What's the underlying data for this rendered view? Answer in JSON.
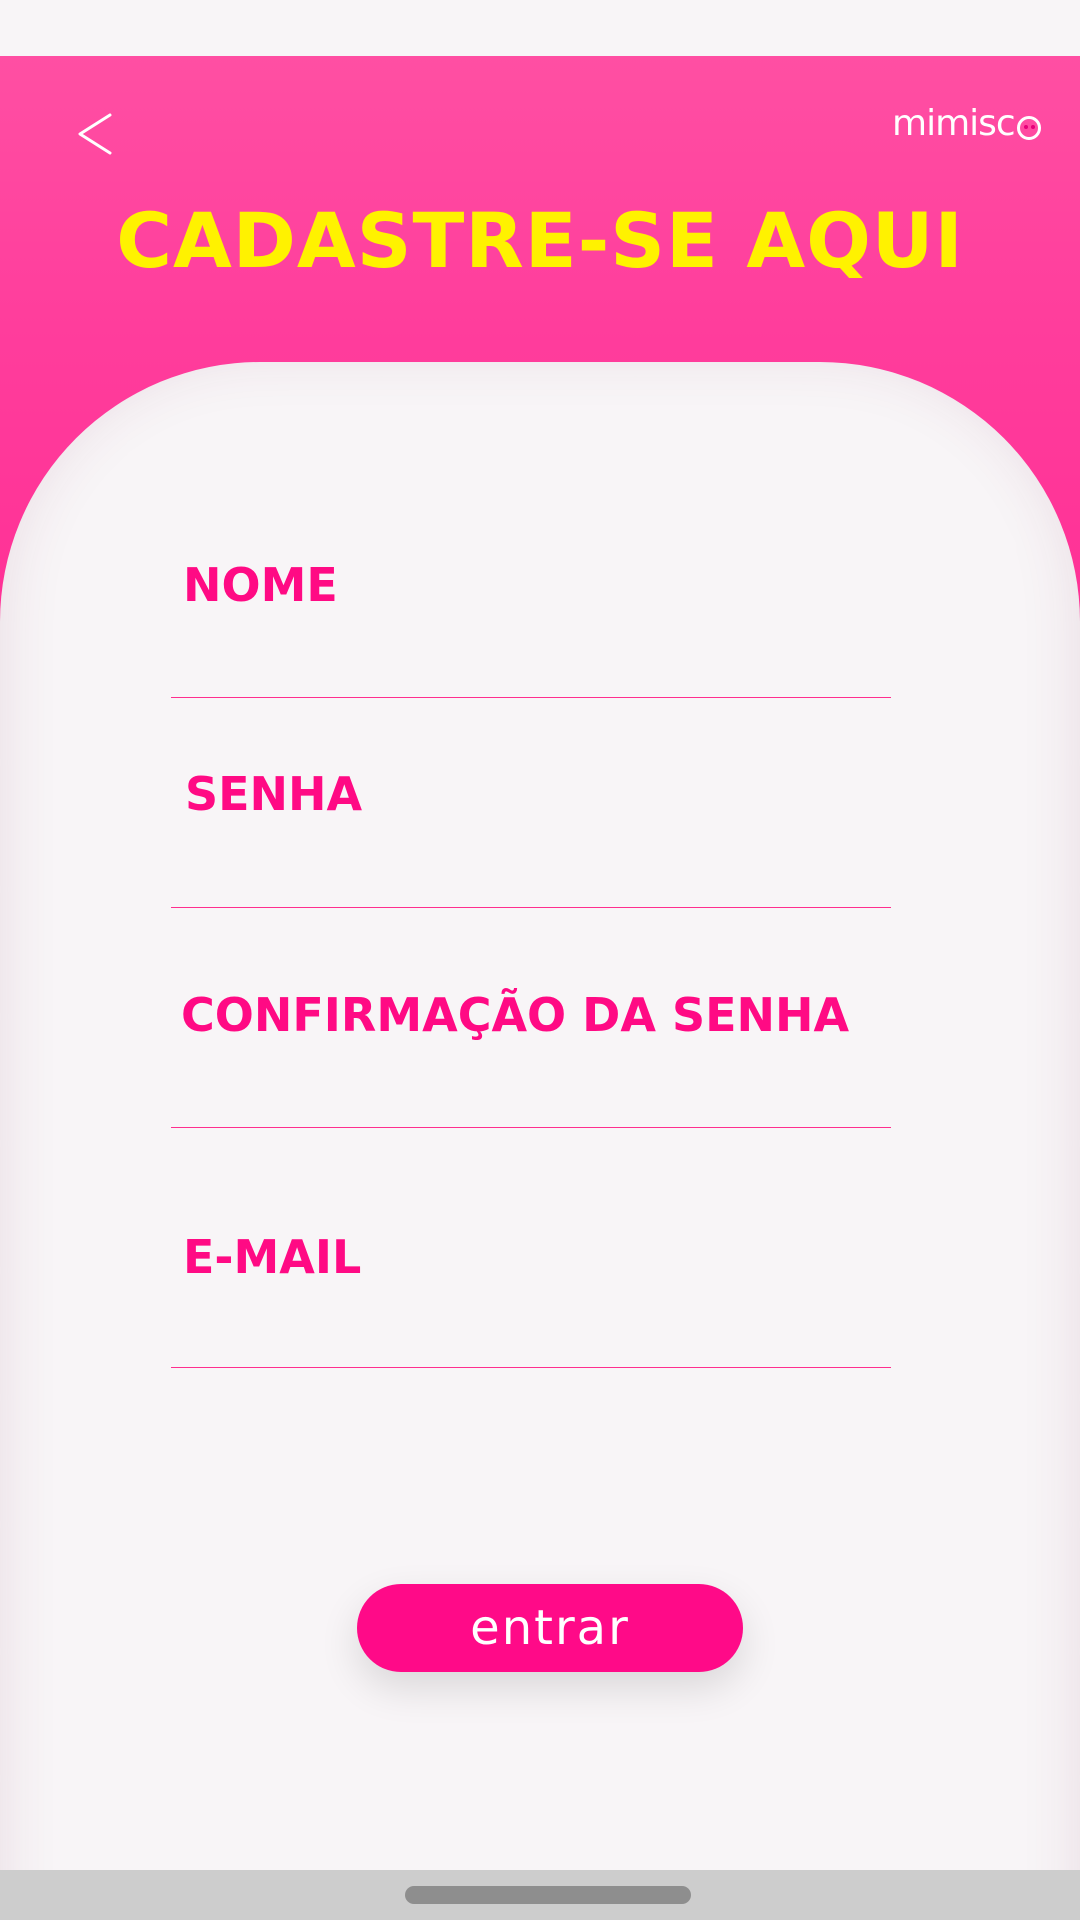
{
  "header": {
    "title": "CADASTRE-SE AQUI",
    "logo_text": "mimisc",
    "back_icon": "chevron-left-icon"
  },
  "form": {
    "fields": [
      {
        "label": "NOME"
      },
      {
        "label": "SENHA"
      },
      {
        "label": "CONFIRMAÇÃO DA SENHA"
      },
      {
        "label": "E-MAIL"
      }
    ],
    "submit_label": "entrar"
  },
  "colors": {
    "header_pink": "#ff3d9c",
    "title_yellow": "#fff200",
    "label_pink": "#ff0a84",
    "button_pink": "#ff0a88",
    "background": "#f8f5f7"
  }
}
